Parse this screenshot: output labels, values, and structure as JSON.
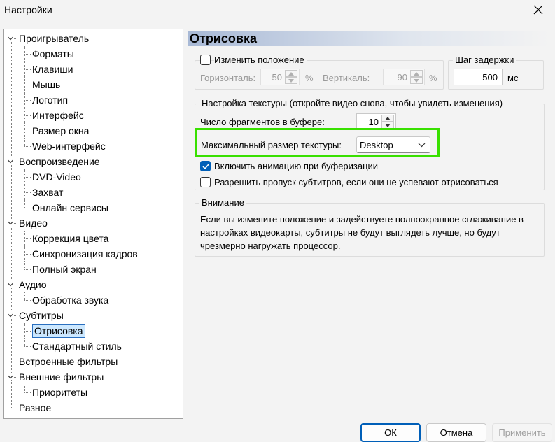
{
  "window": {
    "title": "Настройки"
  },
  "tree": {
    "items": [
      {
        "label": "Проигрыватель",
        "level": 0,
        "expanded": true
      },
      {
        "label": "Форматы",
        "level": 1
      },
      {
        "label": "Клавиши",
        "level": 1
      },
      {
        "label": "Мышь",
        "level": 1
      },
      {
        "label": "Логотип",
        "level": 1
      },
      {
        "label": "Интерфейс",
        "level": 1
      },
      {
        "label": "Размер окна",
        "level": 1
      },
      {
        "label": "Web-интерфейс",
        "level": 1
      },
      {
        "label": "Воспроизведение",
        "level": 0,
        "expanded": true
      },
      {
        "label": "DVD-Video",
        "level": 1
      },
      {
        "label": "Захват",
        "level": 1
      },
      {
        "label": "Онлайн сервисы",
        "level": 1
      },
      {
        "label": "Видео",
        "level": 0,
        "expanded": true
      },
      {
        "label": "Коррекция цвета",
        "level": 1
      },
      {
        "label": "Синхронизация кадров",
        "level": 1
      },
      {
        "label": "Полный экран",
        "level": 1
      },
      {
        "label": "Аудио",
        "level": 0,
        "expanded": true
      },
      {
        "label": "Обработка звука",
        "level": 1
      },
      {
        "label": "Субтитры",
        "level": 0,
        "expanded": true
      },
      {
        "label": "Отрисовка",
        "level": 1,
        "selected": true
      },
      {
        "label": "Стандартный стиль",
        "level": 1
      },
      {
        "label": "Встроенные фильтры",
        "level": 0
      },
      {
        "label": "Внешние фильтры",
        "level": 0,
        "expanded": true
      },
      {
        "label": "Приоритеты",
        "level": 1
      },
      {
        "label": "Разное",
        "level": 0
      }
    ]
  },
  "panel": {
    "title": "Отрисовка",
    "position": {
      "checkbox_label": "Изменить положение",
      "checked": false,
      "horizontal_label": "Горизонталь:",
      "horizontal_value": "50",
      "vertical_label": "Вертикаль:",
      "vertical_value": "90",
      "unit": "%"
    },
    "delay": {
      "legend": "Шаг задержки",
      "value": "500",
      "unit": "мс"
    },
    "texture": {
      "legend": "Настройка текстуры (откройте видео снова, чтобы увидеть изменения)",
      "buffer_label": "Число фрагментов в буфере:",
      "buffer_value": "10",
      "max_size_label": "Максимальный размер текстуры:",
      "max_size_value": "Desktop",
      "animation_label": "Включить анимацию при буферизации",
      "animation_checked": true,
      "skip_label": "Разрешить пропуск субтитров, если они не успевают отрисоваться",
      "skip_checked": false
    },
    "notice": {
      "legend": "Внимание",
      "text": "Если вы измените положение и задействуете полноэкранное сглаживание в настройках видеокарты, субтитры не будут выглядеть лучше, но будут чрезмерно нагружать процессор."
    }
  },
  "buttons": {
    "ok": "ОК",
    "cancel": "Отмена",
    "apply": "Применить"
  },
  "colors": {
    "accent": "#005fb8",
    "highlight": "#39e000",
    "selection": "#cce8ff"
  }
}
